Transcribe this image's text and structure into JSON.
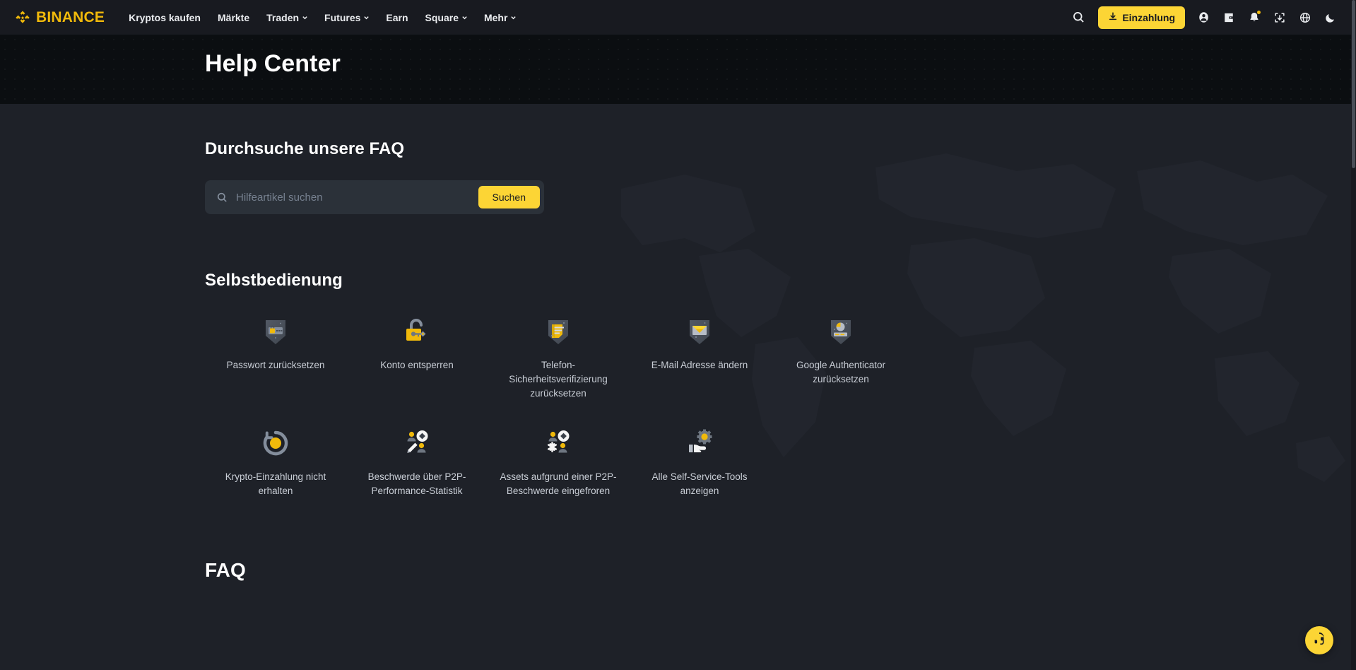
{
  "colors": {
    "brand_yellow": "#f0b90b",
    "button_yellow": "#fcd535",
    "header_bg": "#181a20",
    "hero_bg": "#0b0e11",
    "main_bg": "#1e2128",
    "input_bg": "#2b3139",
    "text_primary": "#eaecef",
    "text_muted": "#848e9c"
  },
  "header": {
    "logo_text": "BINANCE",
    "nav": [
      {
        "label": "Kryptos kaufen",
        "has_caret": false
      },
      {
        "label": "Märkte",
        "has_caret": false
      },
      {
        "label": "Traden",
        "has_caret": true
      },
      {
        "label": "Futures",
        "has_caret": true
      },
      {
        "label": "Earn",
        "has_caret": false
      },
      {
        "label": "Square",
        "has_caret": true
      },
      {
        "label": "Mehr",
        "has_caret": true
      }
    ],
    "deposit_label": "Einzahlung",
    "icons": [
      {
        "name": "search-icon"
      },
      {
        "name": "profile-icon"
      },
      {
        "name": "wallet-icon"
      },
      {
        "name": "notifications-bell-icon"
      },
      {
        "name": "download-app-icon"
      },
      {
        "name": "language-globe-icon"
      },
      {
        "name": "dark-mode-moon-icon"
      }
    ]
  },
  "hero": {
    "title": "Help Center"
  },
  "search_section": {
    "heading": "Durchsuche unsere FAQ",
    "placeholder": "Hilfeartikel suchen",
    "value": "",
    "submit_label": "Suchen"
  },
  "selfservice": {
    "heading": "Selbstbedienung",
    "tiles": [
      {
        "label": "Passwort zurücksetzen",
        "icon": "shield-password-icon"
      },
      {
        "label": "Konto entsperren",
        "icon": "unlock-padlock-key-icon"
      },
      {
        "label": "Telefon-Sicherheitsverifizierung zurücksetzen",
        "icon": "shield-document-icon"
      },
      {
        "label": "E-Mail Adresse ändern",
        "icon": "shield-envelope-icon"
      },
      {
        "label": "Google Authenticator zurücksetzen",
        "icon": "shield-authenticator-icon"
      },
      {
        "label": "Krypto-Einzahlung nicht erhalten",
        "icon": "refresh-coin-icon"
      },
      {
        "label": "Beschwerde über P2P-Performance-Statistik",
        "icon": "p2p-complaint-pencil-icon"
      },
      {
        "label": "Assets aufgrund einer P2P-Beschwerde eingefroren",
        "icon": "p2p-frozen-snowflake-icon"
      },
      {
        "label": "Alle Self-Service-Tools anzeigen",
        "icon": "hand-gear-icon"
      }
    ]
  },
  "faq_section": {
    "heading": "FAQ"
  },
  "support": {
    "fab_icon": "headset-support-icon"
  }
}
